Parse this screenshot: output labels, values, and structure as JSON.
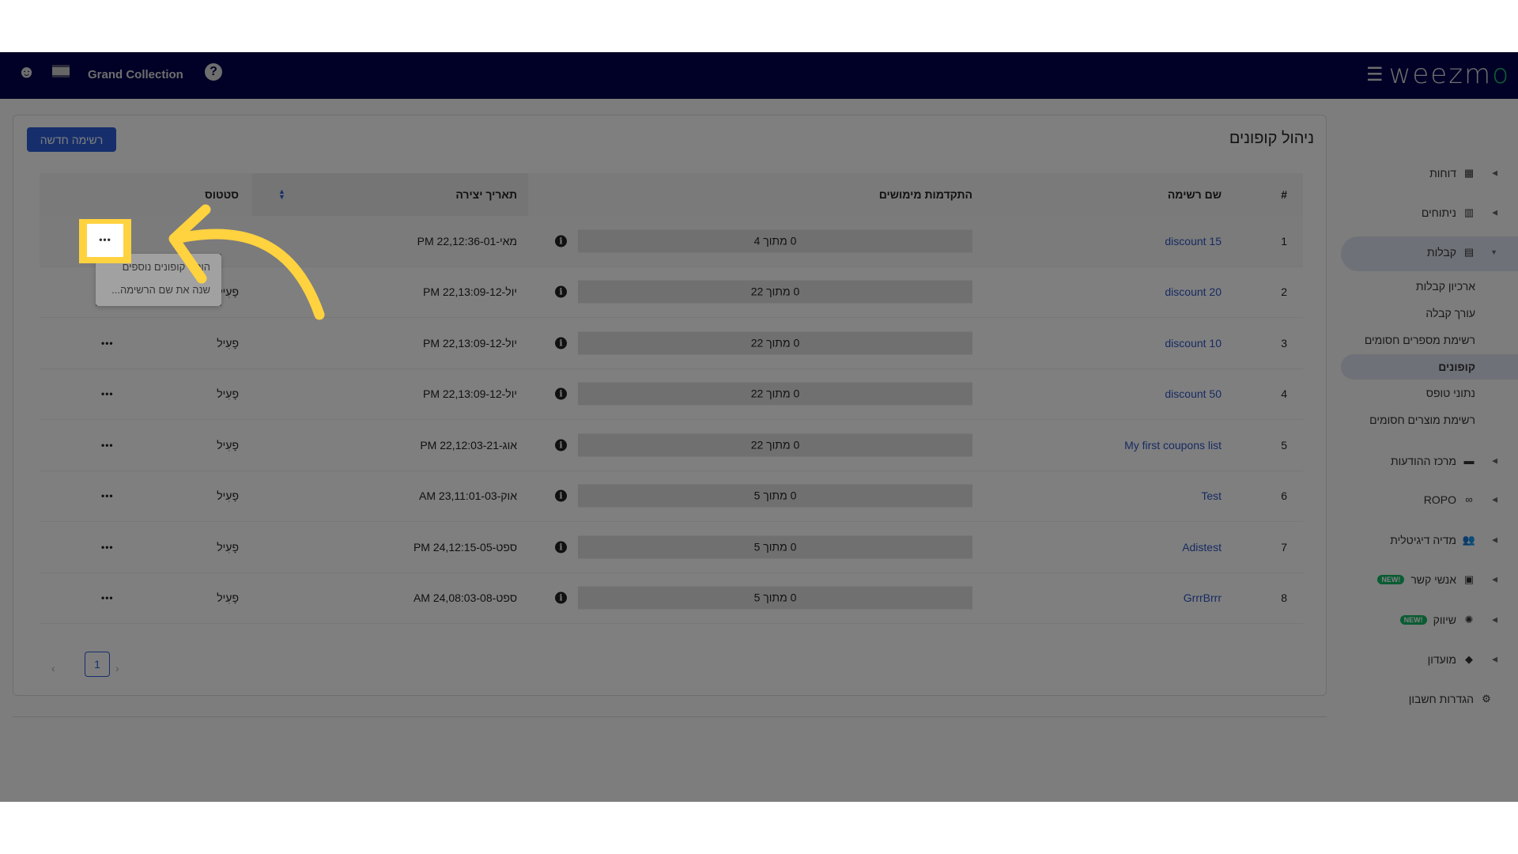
{
  "topbar": {
    "account_name": "Grand Collection",
    "brand": "weezm",
    "brand_accent": "o",
    "icons": [
      "user-circle-icon",
      "israel-flag-icon",
      "help-icon",
      "hamburger-menu-icon"
    ]
  },
  "page": {
    "title": "ניהול קופונים",
    "new_list_button": "רשימה חדשה"
  },
  "table": {
    "headers": {
      "num": "#",
      "name": "שם רשימה",
      "progress": "התקדמות מימושים",
      "date": "תאריך יצירה",
      "status": "סטטוס"
    },
    "rows": [
      {
        "num": "1",
        "name": "discount 15",
        "progress": "0 מתוך 4",
        "date": "PM 22,12:36-מאי-01",
        "status": ""
      },
      {
        "num": "2",
        "name": "discount 20",
        "progress": "0 מתוך 22",
        "date": "PM 22,13:09-יול-12",
        "status": "פָעִיל"
      },
      {
        "num": "3",
        "name": "discount 10",
        "progress": "0 מתוך 22",
        "date": "PM 22,13:09-יול-12",
        "status": "פָעִיל"
      },
      {
        "num": "4",
        "name": "discount 50",
        "progress": "0 מתוך 22",
        "date": "PM 22,13:09-יול-12",
        "status": "פָעִיל"
      },
      {
        "num": "5",
        "name": "My first coupons list",
        "progress": "0 מתוך 22",
        "date": "PM 22,12:03-אוג-21",
        "status": "פָעִיל"
      },
      {
        "num": "6",
        "name": "Test",
        "progress": "0 מתוך 5",
        "date": "AM 23,11:01-אוק-03",
        "status": "פָעִיל"
      },
      {
        "num": "7",
        "name": "Adistest",
        "progress": "0 מתוך 5",
        "date": "PM 24,12:15-ספט-05",
        "status": "פָעִיל"
      },
      {
        "num": "8",
        "name": "GrrrBrrr",
        "progress": "0 מתוך 5",
        "date": "AM 24,08:03-ספט-08",
        "status": "פָעִיל"
      }
    ],
    "row_actions": "•••"
  },
  "pagination": {
    "current": "1",
    "prev": "‹",
    "next": "›"
  },
  "row_menu": {
    "items": [
      "הוסף קופונים נוספים",
      "שנה את שם הרשימה..."
    ]
  },
  "sidebar": {
    "items": [
      {
        "label": "דוחות",
        "icon": "dashboard-icon"
      },
      {
        "label": "ניתוחים",
        "icon": "analytics-icon"
      },
      {
        "label": "קבלות",
        "icon": "receipt-icon",
        "expanded": true
      },
      {
        "label": "מרכז ההודעות",
        "icon": "message-icon"
      },
      {
        "label": "ROPO",
        "icon": "infinity-icon"
      },
      {
        "label": "מדיה דיגיטלית",
        "icon": "people-icon"
      },
      {
        "label": "אנשי קשר",
        "icon": "contacts-icon",
        "badge": "NEW!"
      },
      {
        "label": "שיווק",
        "icon": "party-icon",
        "badge": "NEW!"
      },
      {
        "label": "מועדון",
        "icon": "tag-icon"
      },
      {
        "label": "הגדרות חשבון",
        "icon": "gear-icon"
      }
    ],
    "subitems": [
      "ארכיון קבלות",
      "עורך קבלה",
      "רשימת מספרים חסומים",
      "קופונים",
      "נתוני טופס",
      "רשימת מוצרים חסומים"
    ],
    "active_subitem": "קופונים"
  },
  "colors": {
    "accent": "#2d5ed8",
    "topbar": "#03034f",
    "highlight": "#ffd23f",
    "new_badge": "#14b866"
  }
}
